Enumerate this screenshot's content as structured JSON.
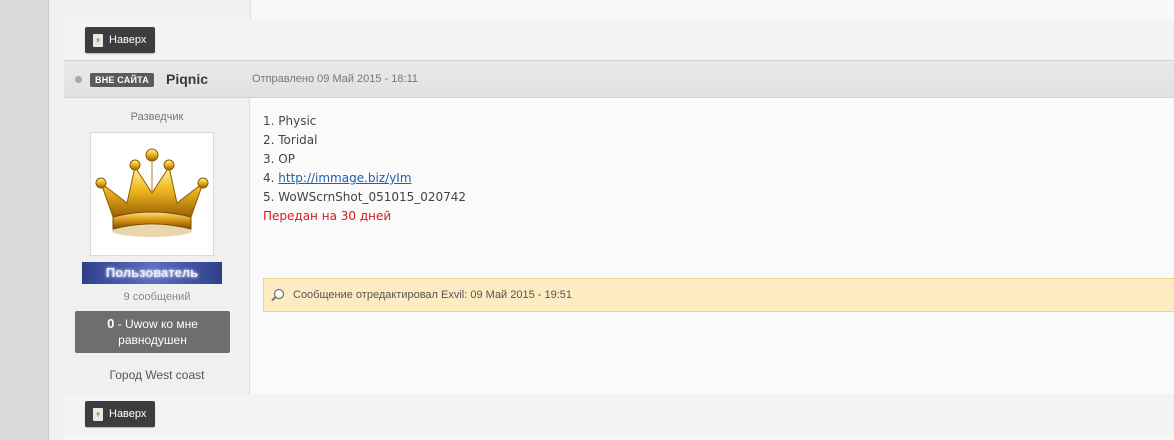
{
  "back_to_top_label": "Наверх",
  "post": {
    "status_badge": "ВНЕ САЙТА",
    "author": "Piqnic",
    "posted": "Отправлено 09 Май 2015 - 18:11",
    "rank": "Разведчик",
    "group": "Пользователь",
    "post_count": "9 сообщений",
    "reputation_value": "0",
    "reputation_text": "- Uwow ко мне равнодушен",
    "city": "Город West coast",
    "lines": {
      "l1": "1. Physic",
      "l2": "2. Toridal",
      "l3": "3. OP",
      "l4_prefix": "4. ",
      "l4_link": "http://immage.biz/yIm",
      "l5": "5. WoWScrnShot_051015_020742"
    },
    "transfer_note": "Передан на 30 дней",
    "edit_note": "Сообщение отредактировал Exvil: 09 Май 2015 - 19:51"
  },
  "colors": {
    "badge": "#5a5a5a",
    "group_bar": "#4455a6",
    "edit_note_bg": "#fdebc2",
    "transfer_note": "#d21f1f",
    "link": "#1f5fae"
  }
}
